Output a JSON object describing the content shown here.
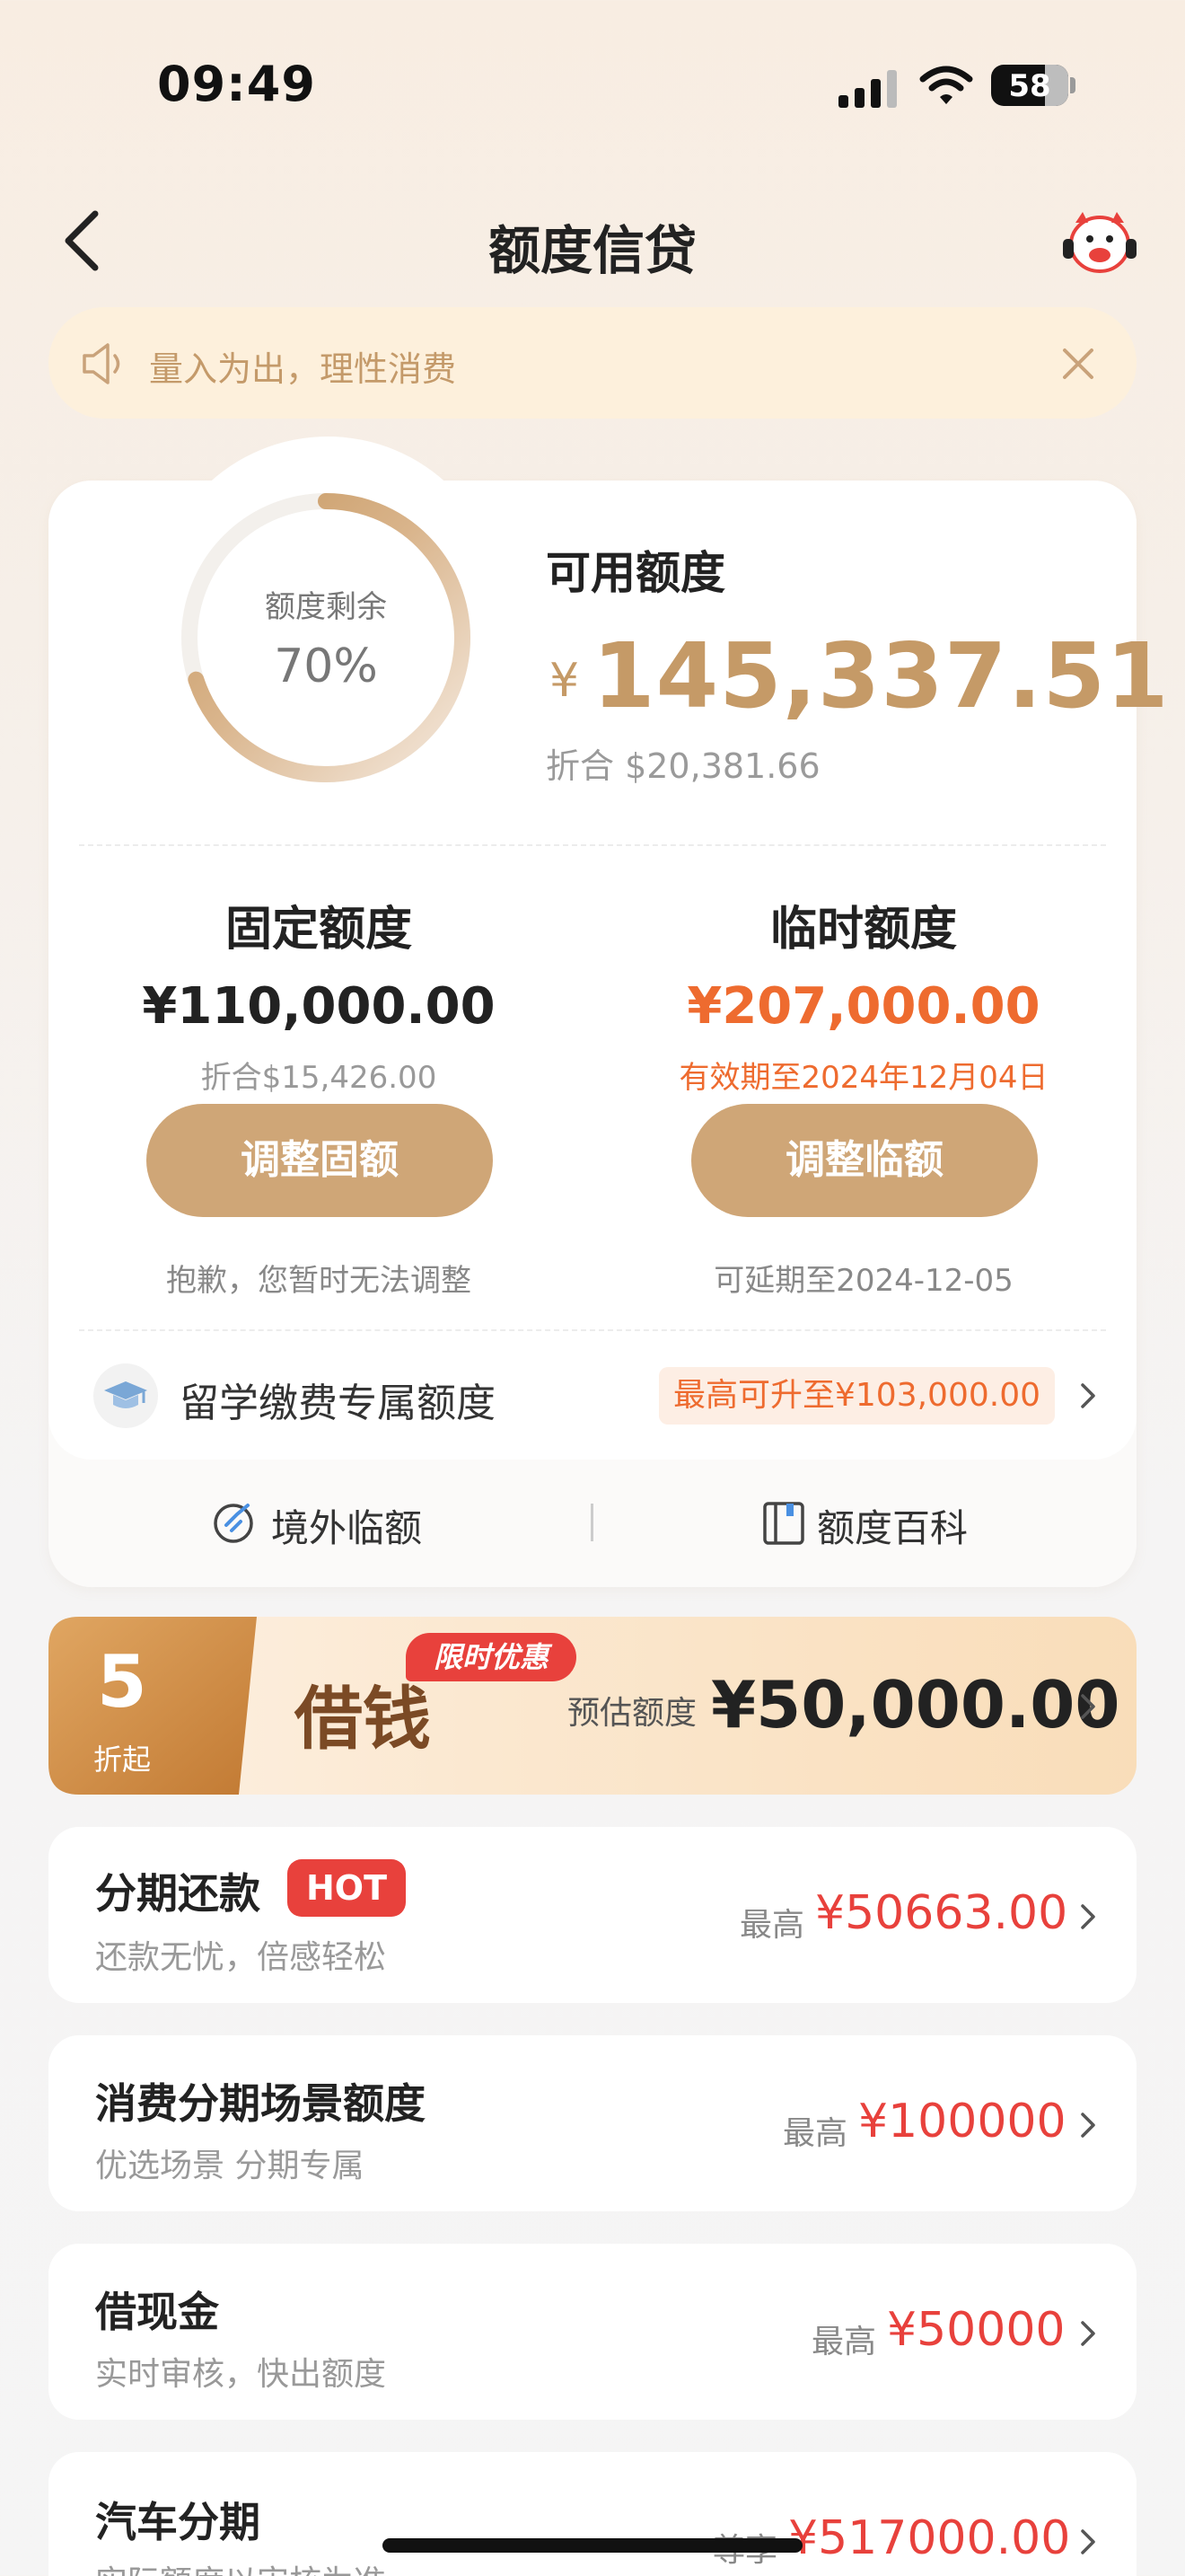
{
  "status_bar": {
    "time": "09:49",
    "battery": "58"
  },
  "nav": {
    "title": "额度信贷"
  },
  "notice": {
    "text": "量入为出，理性消费"
  },
  "quota": {
    "remaining_label": "额度剩余",
    "remaining_percent": "70%",
    "remaining_fraction": 0.7,
    "available_label": "可用额度",
    "currency_symbol": "¥",
    "available_amount": "145,337.51",
    "available_converted": "折合  $20,381.66"
  },
  "fixed": {
    "title": "固定额度",
    "amount": "¥110,000.00",
    "sub": "折合$15,426.00",
    "button": "调整固额",
    "note": "抱歉，您暂时无法调整"
  },
  "temporary": {
    "title": "临时额度",
    "amount": "¥207,000.00",
    "sub": "有效期至2024年12月04日",
    "button": "调整临额",
    "note": "可延期至2024-12-05"
  },
  "study": {
    "label": "留学缴费专属额度",
    "badge": "最高可升至¥103,000.00"
  },
  "tools": [
    {
      "label": "境外临额",
      "icon": "globe-plane-icon"
    },
    {
      "label": "额度百科",
      "icon": "book-icon"
    }
  ],
  "promo": {
    "discount_number": "5",
    "discount_suffix": "折起",
    "tag": "限时优惠",
    "title": "借钱",
    "estimate_label": "预估额度",
    "estimate_amount": "¥50,000.00"
  },
  "products": [
    {
      "title": "分期还款",
      "badge": "HOT",
      "sub": "还款无忧，倍感轻松",
      "max_label": "最高",
      "value": "¥50663.00"
    },
    {
      "title": "消费分期场景额度",
      "sub": "优选场景 分期专属",
      "max_label": "最高",
      "value": "¥100000"
    },
    {
      "title": "借现金",
      "sub": "实时审核，快出额度",
      "max_label": "最高",
      "value": "¥50000"
    },
    {
      "title": "汽车分期",
      "sub": "实际额度以审核为准",
      "max_label": "尊享",
      "value": "¥517000.00"
    }
  ],
  "colors": {
    "gold": "#c59a67",
    "button_gold": "#cfa677",
    "orange": "#ee6b2f",
    "red": "#e8413c"
  }
}
